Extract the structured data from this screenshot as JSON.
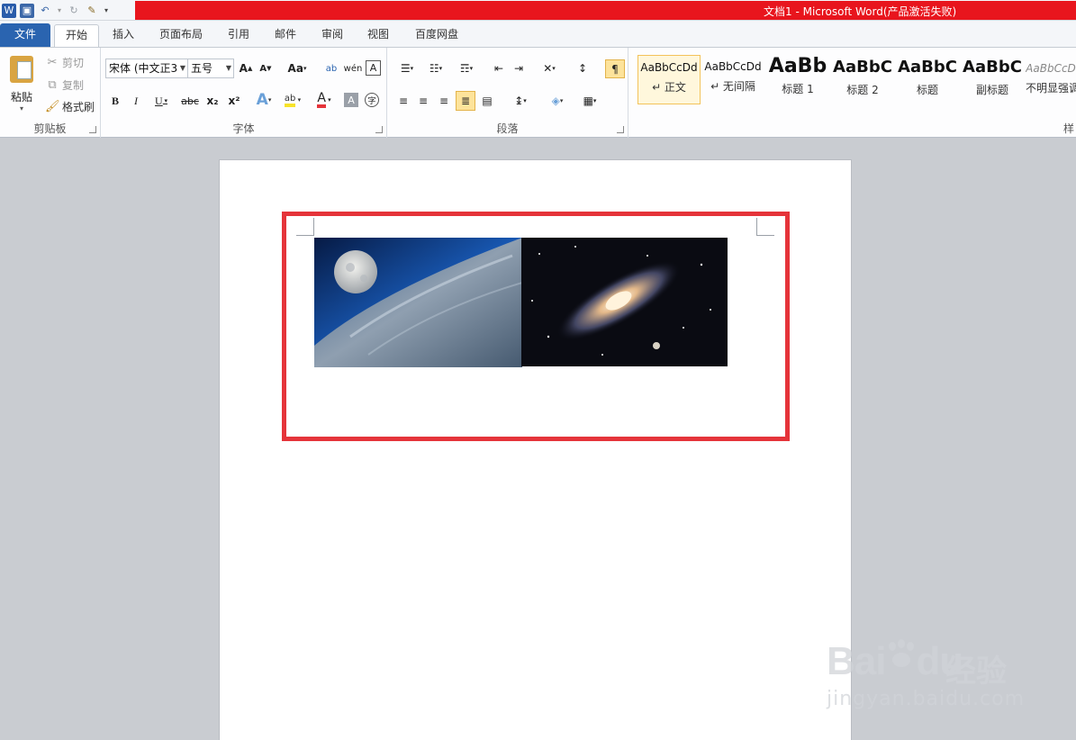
{
  "window": {
    "title": "文档1 - Microsoft Word(产品激活失败)"
  },
  "tabs": [
    {
      "label": "文件"
    },
    {
      "label": "开始"
    },
    {
      "label": "插入"
    },
    {
      "label": "页面布局"
    },
    {
      "label": "引用"
    },
    {
      "label": "邮件"
    },
    {
      "label": "审阅"
    },
    {
      "label": "视图"
    },
    {
      "label": "百度网盘"
    }
  ],
  "clipboard": {
    "paste": "粘贴",
    "cut": "剪切",
    "copy": "复制",
    "format_painter": "格式刷",
    "group_label": "剪贴板"
  },
  "font": {
    "family": "宋体 (中文正3",
    "size": "五号",
    "change_case": "Aa",
    "group_label": "字体",
    "bold": "B",
    "italic": "I",
    "underline": "U",
    "strike": "abc",
    "sub": "x₂",
    "sup": "x²"
  },
  "paragraph": {
    "group_label": "段落"
  },
  "styles": {
    "items": [
      {
        "sample": "AaBbCcDd",
        "name": "↵ 正文"
      },
      {
        "sample": "AaBbCcDd",
        "name": "↵ 无间隔"
      },
      {
        "sample": "AaBb",
        "name": "标题 1"
      },
      {
        "sample": "AaBbC",
        "name": "标题 2"
      },
      {
        "sample": "AaBbC",
        "name": "标题"
      },
      {
        "sample": "AaBbC",
        "name": "副标题"
      },
      {
        "sample": "AaBbCcD",
        "name": "不明显强调"
      }
    ],
    "group_label_partial": "样"
  },
  "watermark": {
    "brand": "Bai",
    "brand2": "du",
    "cn": "经验",
    "url": "jingyan.baidu.com"
  },
  "colors": {
    "file_tab": "#2a64b0",
    "title_bar": "#e8151d",
    "frame": "#e5343a"
  }
}
